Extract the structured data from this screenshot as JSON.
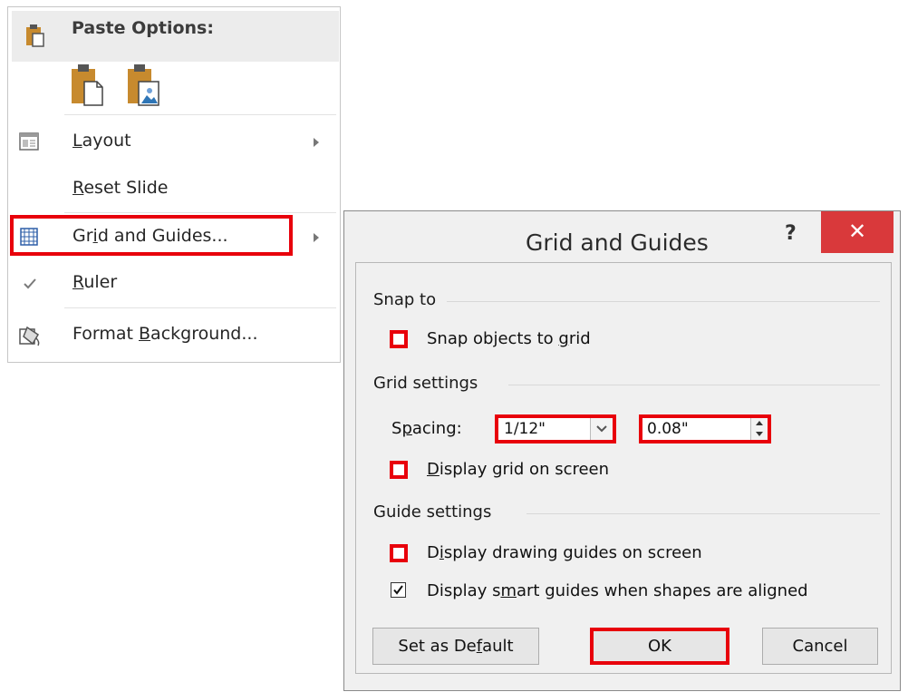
{
  "context_menu": {
    "paste_options_label": "Paste Options:",
    "paste_option_icons": [
      "paste-keep-formatting-icon",
      "paste-picture-icon"
    ],
    "items": [
      {
        "pre": "",
        "key": "L",
        "post": "ayout",
        "icon": "layout-icon",
        "submenu": true
      },
      {
        "pre": "",
        "key": "R",
        "post": "eset Slide",
        "icon": "",
        "submenu": false
      },
      {
        "pre": "Gr",
        "key": "i",
        "post": "d and Guides...",
        "icon": "grid-icon",
        "submenu": true
      },
      {
        "pre": "",
        "key": "R",
        "post": "uler",
        "icon": "checkmark-icon",
        "submenu": false
      },
      {
        "pre": "Format ",
        "key": "B",
        "post": "ackground...",
        "icon": "format-background-icon",
        "submenu": false
      }
    ]
  },
  "dialog": {
    "title": "Grid and Guides",
    "help_label": "?",
    "close_label": "✕",
    "snap_to_label": "Snap to",
    "snap_objects": {
      "pre": "Snap objects to ",
      "key": "g",
      "post": "rid",
      "checked": false
    },
    "grid_settings_label": "Grid settings",
    "spacing": {
      "pre": "S",
      "key": "p",
      "post": "acing:"
    },
    "spacing_select_value": "1/12\"",
    "spacing_number_value": "0.08\"",
    "display_grid": {
      "pre": "",
      "key": "D",
      "post": "isplay grid on screen",
      "checked": false
    },
    "guide_settings_label": "Guide settings",
    "display_guides": {
      "pre": "D",
      "key": "i",
      "post": "splay drawing guides on screen",
      "checked": false
    },
    "smart_guides": {
      "pre": "Display s",
      "key": "m",
      "post": "art guides when shapes are aligned",
      "checked": true
    },
    "set_default": {
      "pre": "Set as De",
      "key": "f",
      "post": "ault"
    },
    "ok_label": "OK",
    "cancel_label": "Cancel"
  },
  "colors": {
    "highlight": "#e8000b",
    "close_button": "#d9393b",
    "dialog_background": "#f0f0f0"
  }
}
